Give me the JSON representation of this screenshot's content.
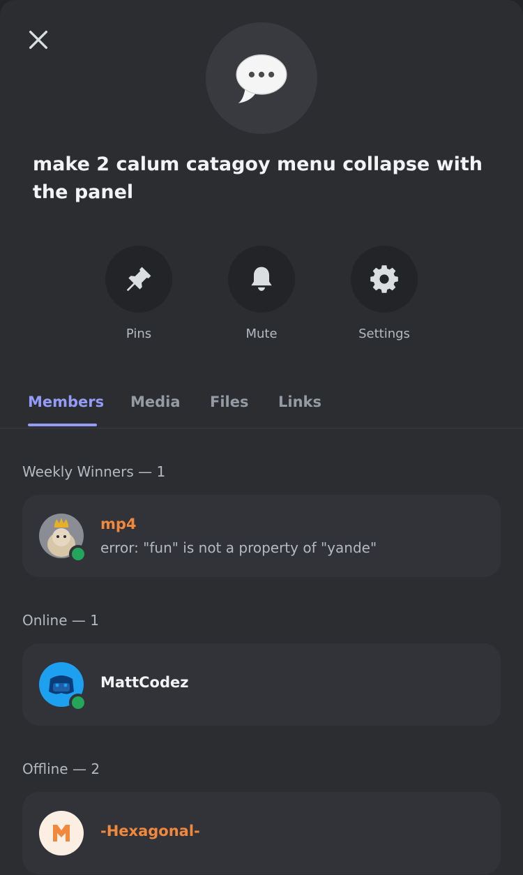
{
  "header": {
    "title": "make 2 calum catagoy menu collapse with the panel"
  },
  "actions": [
    {
      "label": "Pins",
      "icon": "pin-icon"
    },
    {
      "label": "Mute",
      "icon": "bell-icon"
    },
    {
      "label": "Settings",
      "icon": "gear-icon"
    }
  ],
  "tabs": [
    {
      "label": "Members",
      "active": true
    },
    {
      "label": "Media",
      "active": false
    },
    {
      "label": "Files",
      "active": false
    },
    {
      "label": "Links",
      "active": false
    }
  ],
  "sections": [
    {
      "heading": "Weekly Winners — 1",
      "members": [
        {
          "name": "mp4",
          "status_text": "error: \"fun\" is not a property of \"yande\"",
          "name_color": "#f0883e",
          "presence": "online"
        }
      ]
    },
    {
      "heading": "Online — 1",
      "members": [
        {
          "name": "MattCodez",
          "name_color": "#f2f3f5",
          "presence": "online"
        }
      ]
    },
    {
      "heading": "Offline — 2",
      "members": [
        {
          "name": "-Hexagonal-",
          "name_color": "#f0883e",
          "presence": "offline"
        }
      ]
    }
  ],
  "colors": {
    "accent": "#949cf7",
    "online": "#23a55a",
    "background": "#2b2d31",
    "card": "#313338"
  }
}
